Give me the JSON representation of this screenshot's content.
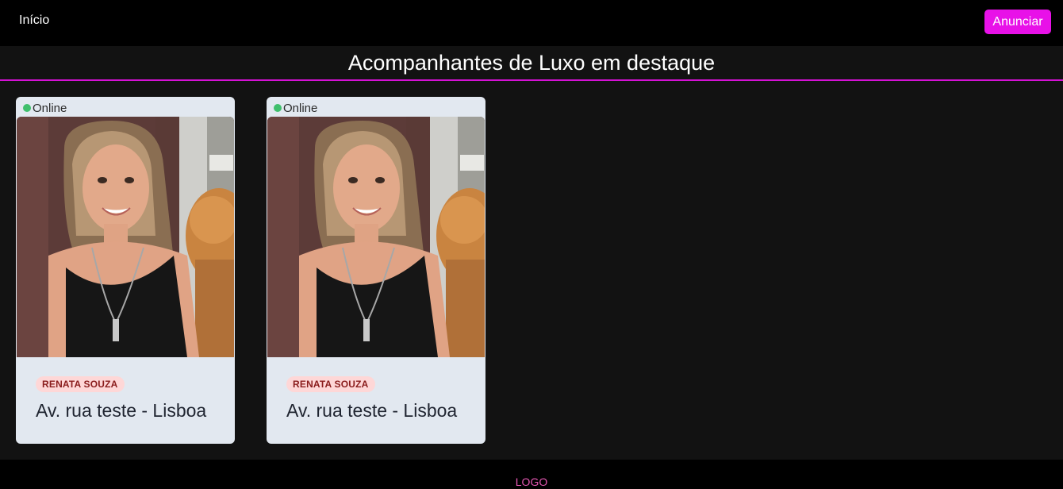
{
  "nav": {
    "home_label": "Início",
    "cta_label": "Anunciar"
  },
  "header": {
    "title": "Acompanhantes de Luxo em destaque"
  },
  "colors": {
    "accent": "#e811e8",
    "online": "#3fbf6c",
    "badge_bg": "#fed7d7"
  },
  "cards": [
    {
      "status": "Online",
      "name": "RENATA SOUZA",
      "address": "Av. rua teste - Lisboa",
      "photo_icon": "portrait-photo"
    },
    {
      "status": "Online",
      "name": "RENATA SOUZA",
      "address": "Av. rua teste - Lisboa",
      "photo_icon": "portrait-photo"
    }
  ],
  "footer": {
    "logo_text": "LOGO"
  }
}
